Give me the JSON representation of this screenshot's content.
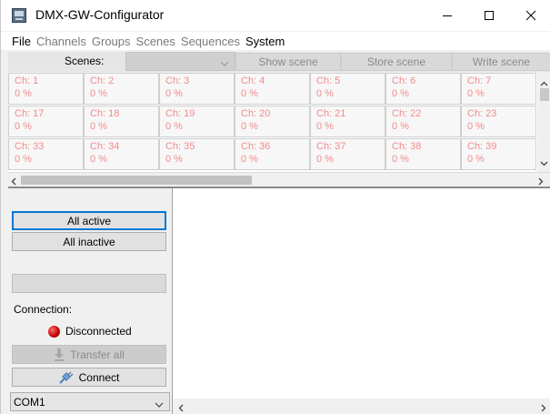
{
  "window": {
    "title": "DMX-GW-Configurator",
    "icon": "app-icon",
    "controls": [
      "minimize-icon",
      "maximize-icon",
      "close-icon"
    ]
  },
  "menu": [
    {
      "label": "File",
      "enabled": true
    },
    {
      "label": "Channels",
      "enabled": false
    },
    {
      "label": "Groups",
      "enabled": false
    },
    {
      "label": "Scenes",
      "enabled": false
    },
    {
      "label": "Sequences",
      "enabled": false
    },
    {
      "label": "System",
      "enabled": true
    }
  ],
  "scenes_bar": {
    "label": "Scenes:",
    "selected": "",
    "show_label": "Show scene",
    "store_label": "Store scene",
    "write_label": "Write scene"
  },
  "channels": {
    "rows": [
      [
        {
          "name": "Ch: 1",
          "value": "0 %"
        },
        {
          "name": "Ch: 2",
          "value": "0 %"
        },
        {
          "name": "Ch: 3",
          "value": "0 %"
        },
        {
          "name": "Ch: 4",
          "value": "0 %"
        },
        {
          "name": "Ch: 5",
          "value": "0 %"
        },
        {
          "name": "Ch: 6",
          "value": "0 %"
        },
        {
          "name": "Ch: 7",
          "value": "0 %"
        }
      ],
      [
        {
          "name": "Ch: 17",
          "value": "0 %"
        },
        {
          "name": "Ch: 18",
          "value": "0 %"
        },
        {
          "name": "Ch: 19",
          "value": "0 %"
        },
        {
          "name": "Ch: 20",
          "value": "0 %"
        },
        {
          "name": "Ch: 21",
          "value": "0 %"
        },
        {
          "name": "Ch: 22",
          "value": "0 %"
        },
        {
          "name": "Ch: 23",
          "value": "0 %"
        }
      ],
      [
        {
          "name": "Ch: 33",
          "value": "0 %"
        },
        {
          "name": "Ch: 34",
          "value": "0 %"
        },
        {
          "name": "Ch: 35",
          "value": "0 %"
        },
        {
          "name": "Ch: 36",
          "value": "0 %"
        },
        {
          "name": "Ch: 37",
          "value": "0 %"
        },
        {
          "name": "Ch: 38",
          "value": "0 %"
        },
        {
          "name": "Ch: 39",
          "value": "0 %"
        }
      ]
    ],
    "text_color": "#f08c8c"
  },
  "left_panel": {
    "all_active": "All active",
    "all_inactive": "All inactive",
    "connection_label": "Connection:",
    "status": "Disconnected",
    "status_color": "#c00000",
    "transfer_all": "Transfer all",
    "connect": "Connect",
    "port": "COM1"
  },
  "colors": {
    "focus": "#0078d7"
  }
}
